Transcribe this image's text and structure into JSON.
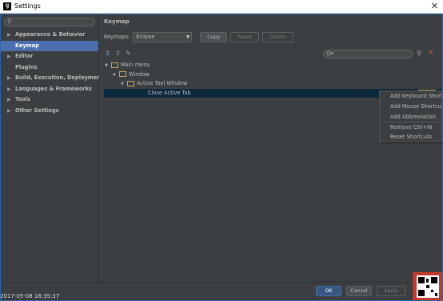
{
  "window": {
    "title": "Settings",
    "app_icon_text": "IJ"
  },
  "sidebar": {
    "search_placeholder": "",
    "items": [
      {
        "label": "Appearance & Behavior",
        "expandable": true
      },
      {
        "label": "Keymap",
        "expandable": false,
        "active": true
      },
      {
        "label": "Editor",
        "expandable": true
      },
      {
        "label": "Plugins",
        "expandable": false
      },
      {
        "label": "Build, Execution, Deployment",
        "expandable": true
      },
      {
        "label": "Languages & Frameworks",
        "expandable": true
      },
      {
        "label": "Tools",
        "expandable": true
      },
      {
        "label": "Other Settings",
        "expandable": true
      }
    ]
  },
  "main": {
    "title": "Keymap",
    "keymaps_label": "Keymaps:",
    "keymap_selected": "Eclipse",
    "buttons": {
      "copy": "Copy",
      "reset": "Reset",
      "delete": "Delete"
    },
    "find_placeholder": "Q▾"
  },
  "tree": [
    {
      "label": "Main menu",
      "level": 0,
      "expanded": true,
      "folder": true
    },
    {
      "label": "Window",
      "level": 1,
      "expanded": true,
      "folder": true
    },
    {
      "label": "Active Tool Window",
      "level": 2,
      "expanded": true,
      "folder": true
    },
    {
      "label": "Close Active Tab",
      "level": 3,
      "expanded": false,
      "folder": false,
      "selected": true
    }
  ],
  "context_menu": {
    "items": [
      "Add Keyboard Shortcut",
      "Add Mouse Shortcut",
      "Add Abbreviation",
      "Remove Ctrl+W",
      "Reset Shortcuts"
    ]
  },
  "footer": {
    "ok": "OK",
    "cancel": "Cancel",
    "apply": "Apply"
  },
  "timestamp": "2017-05-08 16:35:37",
  "colors": {
    "selection": "#4b6eaf",
    "background": "#3c3f41",
    "tree_selection": "#0d293e",
    "overlay": "#c0392b"
  }
}
